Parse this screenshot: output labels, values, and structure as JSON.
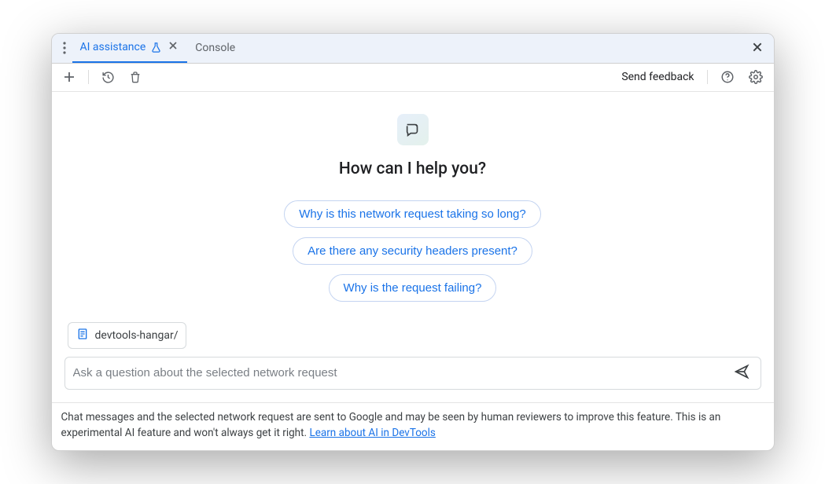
{
  "tabs": {
    "ai_assistance": "AI assistance",
    "console": "Console"
  },
  "toolbar": {
    "send_feedback": "Send feedback"
  },
  "heading": "How can I help you?",
  "suggestions": [
    "Why is this network request taking so long?",
    "Are there any security headers present?",
    "Why is the request failing?"
  ],
  "context": {
    "label": "devtools-hangar/"
  },
  "input": {
    "placeholder": "Ask a question about the selected network request"
  },
  "footer": {
    "text_a": "Chat messages and the selected network request are sent to Google and may be seen by human reviewers to improve this feature. This is an experimental AI feature and won't always get it right. ",
    "link": "Learn about AI in DevTools"
  }
}
